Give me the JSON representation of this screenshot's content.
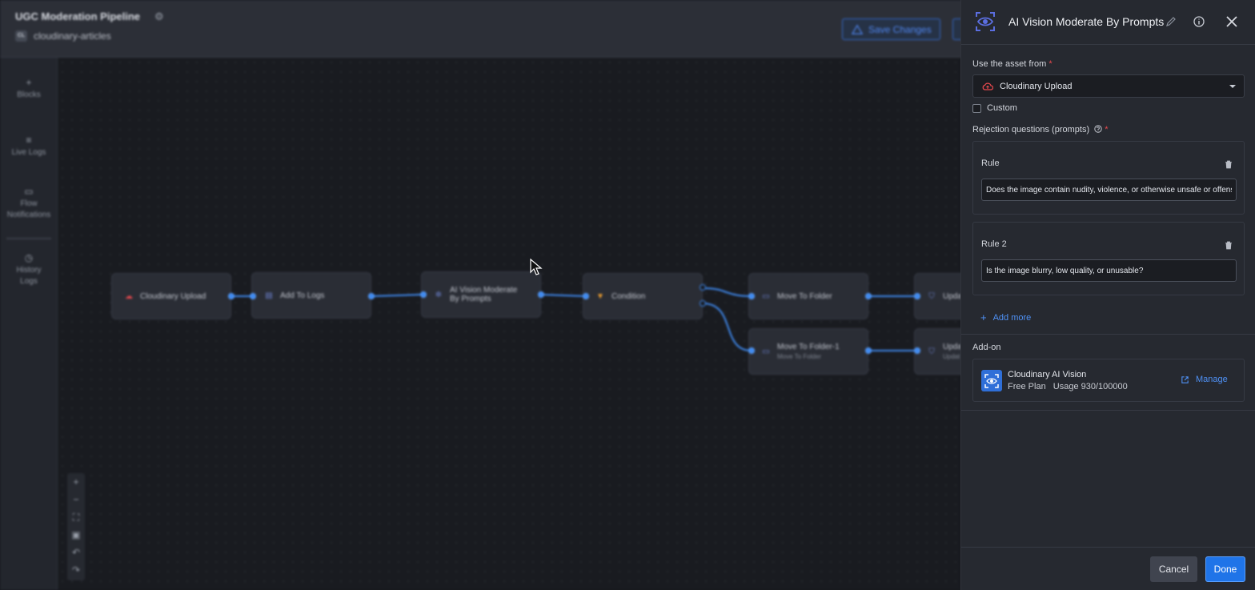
{
  "header": {
    "pipeline_title": "UGC Moderation Pipeline",
    "project_badge": "CL",
    "project_name": "cloudinary-articles",
    "save_label": "Save Changes"
  },
  "sidebar": {
    "items": [
      {
        "icon": "plus-icon",
        "label": "Blocks"
      },
      {
        "icon": "list-icon",
        "label": "Live Logs"
      },
      {
        "icon": "message-icon",
        "label_line1": "Flow",
        "label_line2": "Notifications"
      },
      {
        "icon": "history-icon",
        "label_line1": "History",
        "label_line2": "Logs"
      }
    ]
  },
  "canvas": {
    "nodes": {
      "upload": {
        "label": "Cloudinary Upload",
        "icon": "cloud-icon"
      },
      "logs": {
        "label": "Add To Logs",
        "icon": "log-icon"
      },
      "vision": {
        "label_line1": "AI Vision Moderate",
        "label_line2": "By Prompts",
        "icon": "ai-icon"
      },
      "condition": {
        "label": "Condition",
        "icon": "funnel-icon"
      },
      "move": {
        "label": "Move To Folder",
        "icon": "folder-icon"
      },
      "move1": {
        "label": "Move To Folder-1",
        "sublabel": "Move To Folder",
        "icon": "folder-icon"
      },
      "update_a": {
        "label": "Upda",
        "icon": "shield-icon"
      },
      "update_b": {
        "label": "Upda",
        "sublabel": "Updat",
        "icon": "shield-icon"
      }
    }
  },
  "panel": {
    "title": "AI Vision Moderate By Prompts",
    "asset_label": "Use the asset from",
    "required_mark": "*",
    "asset_value": "Cloudinary Upload",
    "custom_label": "Custom",
    "rejection_label": "Rejection questions (prompts)",
    "rules": [
      {
        "label": "Rule",
        "value": "Does the image contain nudity, violence, or otherwise unsafe or offensive content?"
      },
      {
        "label": "Rule 2",
        "value": "Is the image blurry, low quality, or unusable?"
      }
    ],
    "add_more": "Add more",
    "addon_label": "Add-on",
    "addon": {
      "name": "Cloudinary AI Vision",
      "plan": "Free Plan",
      "usage": "Usage 930/100000",
      "manage": "Manage"
    },
    "cancel": "Cancel",
    "done": "Done"
  },
  "colors": {
    "accent": "#1f74e8",
    "link": "#4f91f5",
    "required": "#e5484d",
    "edge": "#3f8af0"
  }
}
